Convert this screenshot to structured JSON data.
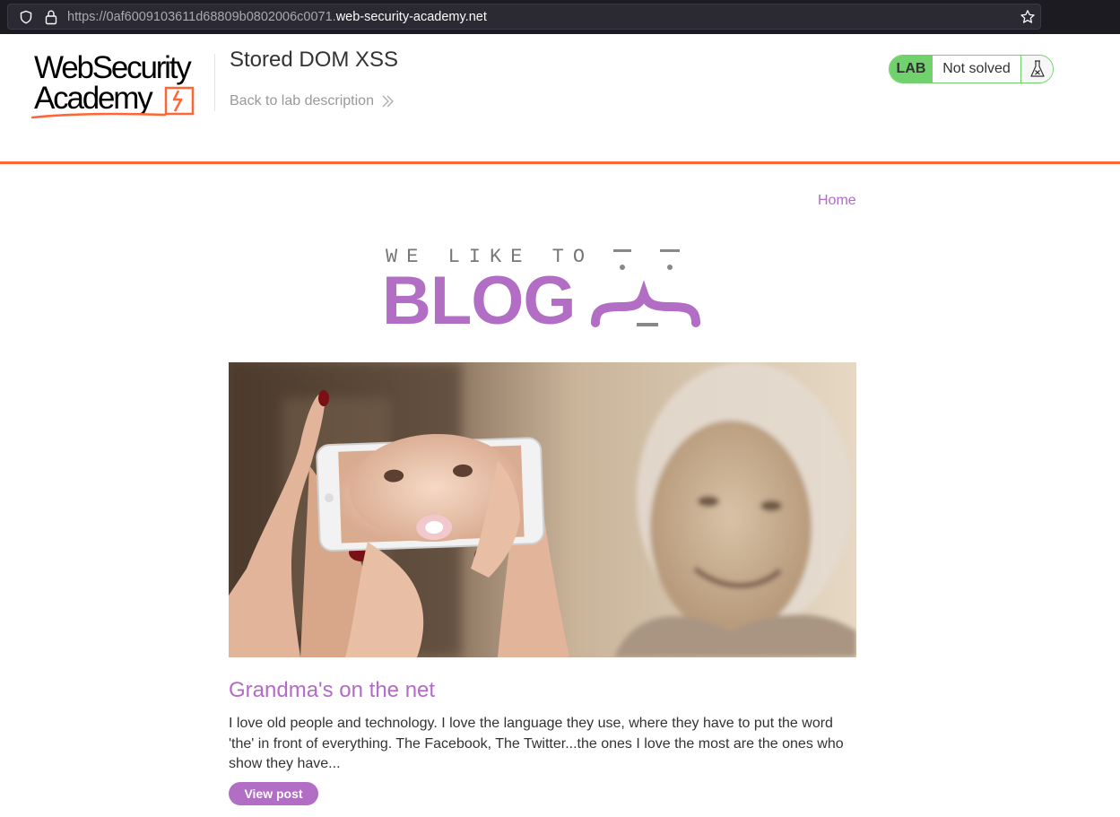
{
  "browser": {
    "url_prefix": "https://0af6009103611d68809b0802006c0071.",
    "url_domain": "web-security-academy.net"
  },
  "academy_header": {
    "logo_line1": "WebSecurity",
    "logo_line2": "Academy",
    "lab_title": "Stored DOM XSS",
    "back_link": "Back to lab description",
    "status_tag": "LAB",
    "status_text": "Not solved"
  },
  "colors": {
    "accent_orange": "#ff6633",
    "lab_green": "#70d16d",
    "blog_purple": "#b16ec4"
  },
  "blog": {
    "nav_home": "Home",
    "banner_small": "WE LIKE TO",
    "banner_big": "BLOG",
    "post": {
      "title": "Grandma's on the net",
      "summary": "I love old people and technology. I love the language they use, where they have to put the word 'the' in front of everything. The Facebook, The Twitter...the ones I love the most are the ones who show they have...",
      "button": "View post"
    }
  }
}
